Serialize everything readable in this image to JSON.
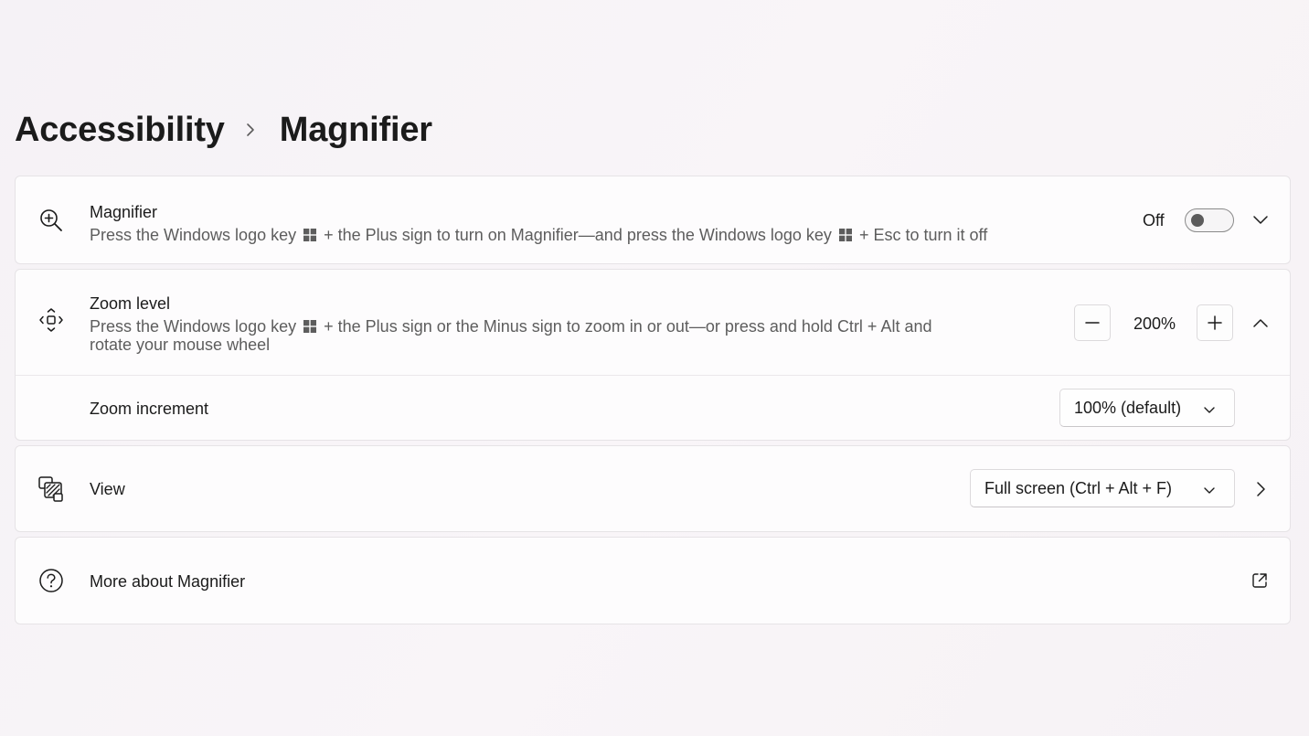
{
  "breadcrumb": {
    "parent": "Accessibility",
    "current": "Magnifier"
  },
  "magnifier_card": {
    "title": "Magnifier",
    "desc_part1": "Press the Windows logo key",
    "desc_part2": "+ the Plus sign to turn on Magnifier—and press the Windows logo key",
    "desc_part3": "+ Esc to turn it off",
    "toggle_state": "Off",
    "icon": "zoom-in-icon"
  },
  "zoom_card": {
    "title": "Zoom level",
    "desc_part1": "Press the Windows logo key",
    "desc_part2": "+ the Plus sign or the Minus sign to zoom in or out—or press and hold Ctrl + Alt and",
    "desc_line2": "rotate your mouse wheel",
    "zoom_value": "200%",
    "increment_label": "Zoom increment",
    "increment_value": "100% (default)",
    "icon": "move-icon"
  },
  "view_card": {
    "title": "View",
    "value": "Full screen (Ctrl + Alt + F)",
    "icon": "view-icon"
  },
  "more_card": {
    "title": "More about Magnifier",
    "icon": "help-icon"
  },
  "colors": {
    "accent_text": "#1b1b1b",
    "secondary_text": "#5d5d5d"
  }
}
